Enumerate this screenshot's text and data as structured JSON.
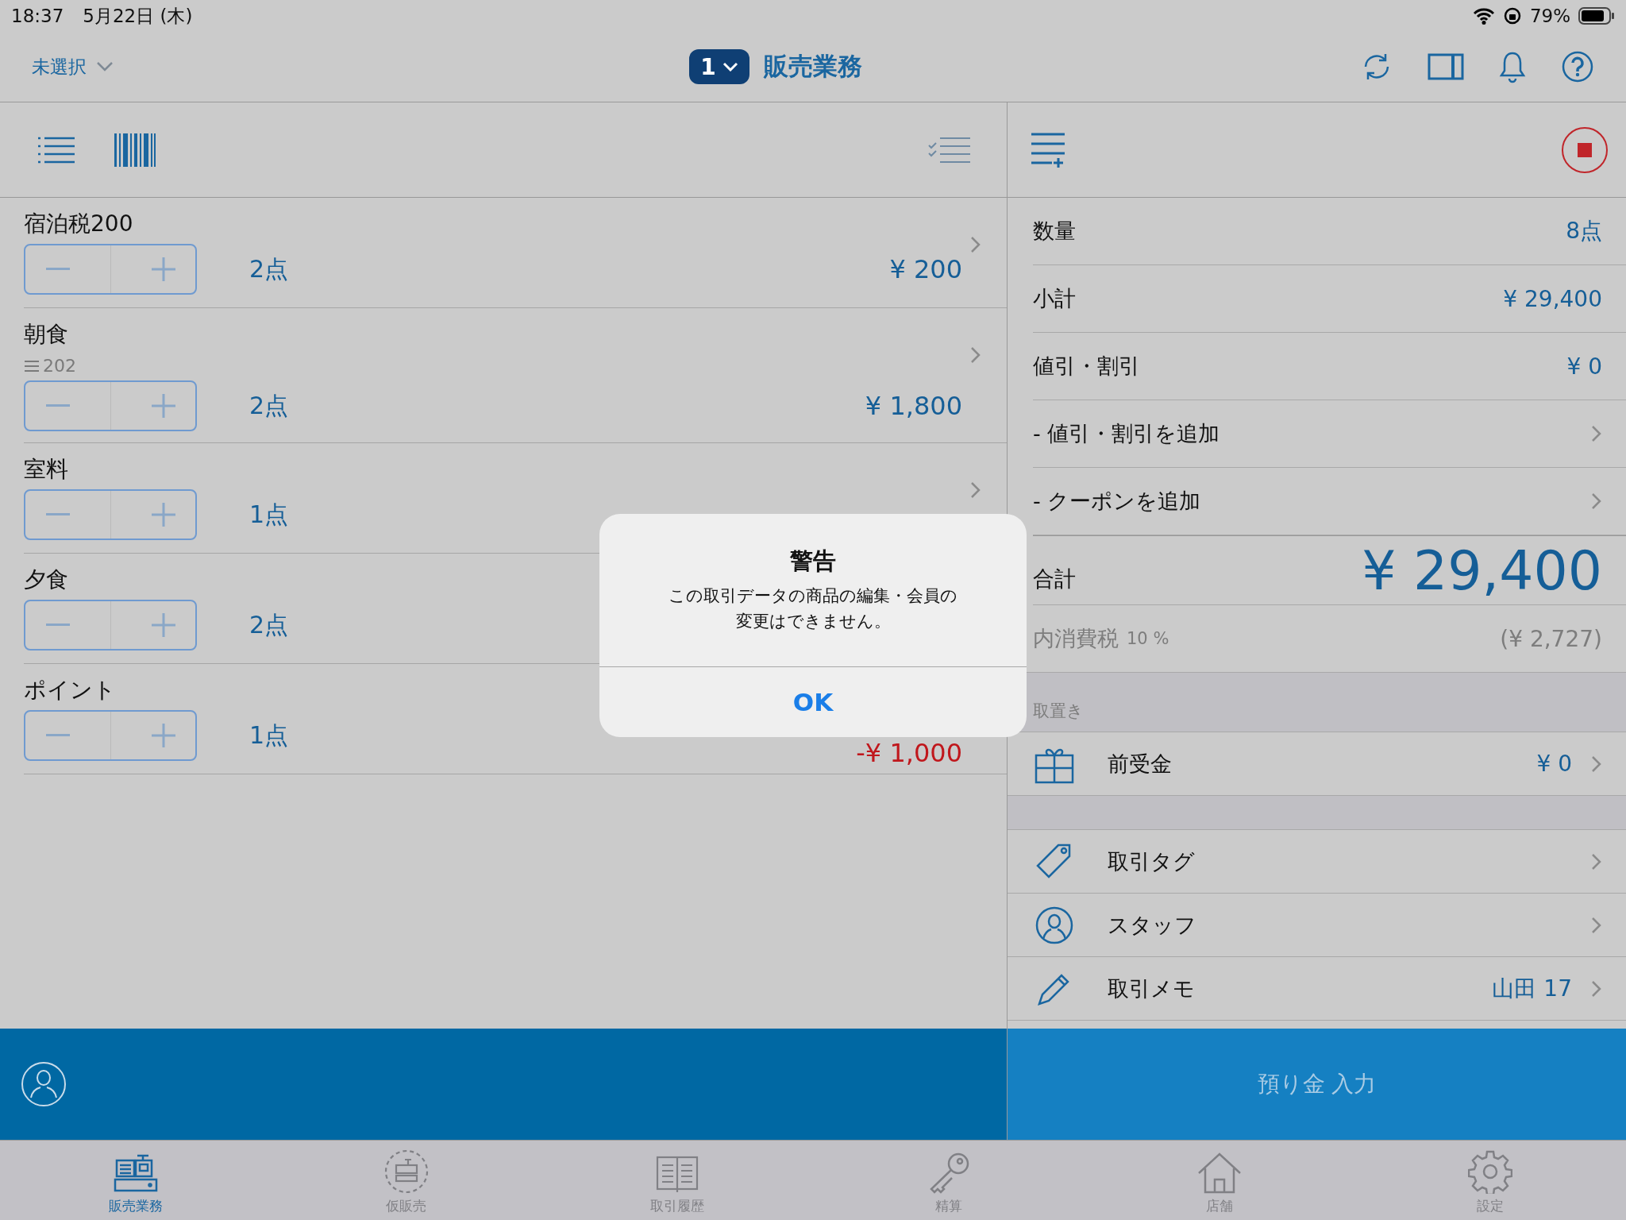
{
  "status_bar": {
    "time": "18:37",
    "date": "5月22日 (木)",
    "battery": "79%"
  },
  "nav": {
    "store_picker": "未選択",
    "register_number": "1",
    "title": "販売業務"
  },
  "cart_items": [
    {
      "name": "宿泊税200",
      "quantity": "2点",
      "price": "¥ 200",
      "negative": false
    },
    {
      "name": "朝食",
      "code": "202",
      "quantity": "2点",
      "price": "¥ 1,800",
      "negative": false
    },
    {
      "name": "室料",
      "quantity": "1点"
    },
    {
      "name": "夕食",
      "quantity": "2点"
    },
    {
      "name": "ポイント",
      "quantity": "1点",
      "price": "-¥ 1,000",
      "negative": true
    }
  ],
  "summary": [
    {
      "kind": "value",
      "label": "数量",
      "value": "8点"
    },
    {
      "kind": "value",
      "label": "小計",
      "value": "¥ 29,400"
    },
    {
      "kind": "value",
      "label": "値引・割引",
      "value": "¥ 0"
    },
    {
      "kind": "link",
      "label": "- 値引・割引を追加"
    },
    {
      "kind": "link",
      "label": "- クーポンを追加"
    }
  ],
  "total": {
    "label": "合計",
    "value": "¥ 29,400"
  },
  "tax": {
    "label": "内消費税",
    "rate": "10 %",
    "value": "(¥ 2,727)"
  },
  "reserve_section": {
    "header": "取置き",
    "rows": [
      {
        "kind": "gift",
        "label": "前受金",
        "value": "¥ 0"
      }
    ]
  },
  "detail_rows": [
    {
      "kind": "tag",
      "label": "取引タグ"
    },
    {
      "kind": "staff",
      "label": "スタッフ"
    },
    {
      "kind": "memo",
      "label": "取引メモ",
      "value": "山田 17"
    }
  ],
  "checkout": {
    "button": "預り金 入力"
  },
  "tabs": [
    {
      "kind": "register",
      "label": "販売業務",
      "selected": true
    },
    {
      "kind": "hold",
      "label": "仮販売",
      "selected": false
    },
    {
      "kind": "history",
      "label": "取引履歴",
      "selected": false
    },
    {
      "kind": "key",
      "label": "精算",
      "selected": false
    },
    {
      "kind": "store",
      "label": "店舗",
      "selected": false
    },
    {
      "kind": "settings",
      "label": "設定",
      "selected": false
    }
  ],
  "alert": {
    "title": "警告",
    "message": "この取引データの商品の編集・会員の変更はできません。",
    "button": "OK"
  }
}
